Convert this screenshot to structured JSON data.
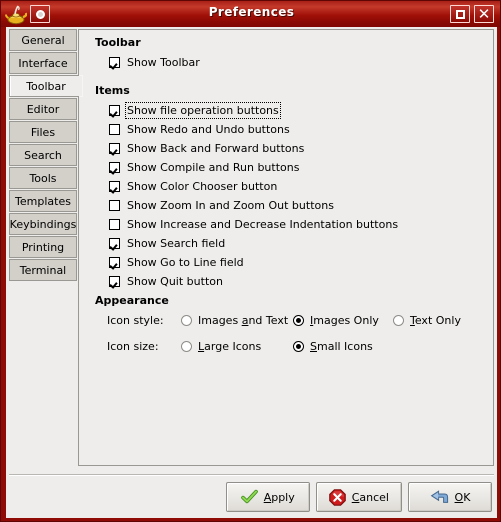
{
  "window": {
    "title": "Preferences",
    "app_icon": "genie-lamp-icon",
    "menu_button_icon": "window-menu-icon",
    "maximize_button_icon": "maximize-icon",
    "close_button_icon": "close-icon",
    "titlebar_color": "#a01008",
    "frame_color": "#8e0b06",
    "background_color": "#eeedeb"
  },
  "sidebar": {
    "items": [
      {
        "label": "General",
        "selected": false
      },
      {
        "label": "Interface",
        "selected": false
      },
      {
        "label": "Toolbar",
        "selected": true
      },
      {
        "label": "Editor",
        "selected": false
      },
      {
        "label": "Files",
        "selected": false
      },
      {
        "label": "Search",
        "selected": false
      },
      {
        "label": "Tools",
        "selected": false
      },
      {
        "label": "Templates",
        "selected": false
      },
      {
        "label": "Keybindings",
        "selected": false
      },
      {
        "label": "Printing",
        "selected": false
      },
      {
        "label": "Terminal",
        "selected": false
      }
    ]
  },
  "panel": {
    "toolbar_section": {
      "heading": "Toolbar",
      "options": [
        {
          "label": "Show Toolbar",
          "checked": true,
          "focused": false
        }
      ]
    },
    "items_section": {
      "heading": "Items",
      "options": [
        {
          "label": "Show file operation buttons",
          "checked": true,
          "focused": true
        },
        {
          "label": "Show Redo and Undo buttons",
          "checked": false,
          "focused": false
        },
        {
          "label": "Show Back and Forward buttons",
          "checked": true,
          "focused": false
        },
        {
          "label": "Show Compile and Run buttons",
          "checked": true,
          "focused": false
        },
        {
          "label": "Show Color Chooser button",
          "checked": true,
          "focused": false
        },
        {
          "label": "Show Zoom In and Zoom Out buttons",
          "checked": false,
          "focused": false
        },
        {
          "label": "Show Increase and Decrease Indentation buttons",
          "checked": false,
          "focused": false
        },
        {
          "label": "Show Search field",
          "checked": true,
          "focused": false
        },
        {
          "label": "Show Go to Line field",
          "checked": true,
          "focused": false
        },
        {
          "label": "Show Quit button",
          "checked": true,
          "focused": false
        }
      ]
    },
    "appearance_section": {
      "heading": "Appearance",
      "icon_style": {
        "label": "Icon style:",
        "options": [
          {
            "pre": "Images ",
            "accel": "a",
            "post": "nd Text",
            "selected": false
          },
          {
            "pre": "",
            "accel": "I",
            "post": "mages Only",
            "selected": true
          },
          {
            "pre": "",
            "accel": "T",
            "post": "ext Only",
            "selected": false
          }
        ]
      },
      "icon_size": {
        "label": "Icon size:",
        "options": [
          {
            "pre": "",
            "accel": "L",
            "post": "arge Icons",
            "selected": false
          },
          {
            "pre": "",
            "accel": "S",
            "post": "mall Icons",
            "selected": true
          }
        ]
      }
    }
  },
  "actions": {
    "apply": {
      "pre": "",
      "accel": "A",
      "post": "pply",
      "icon": "green-check-icon"
    },
    "cancel": {
      "pre": "",
      "accel": "C",
      "post": "ancel",
      "icon": "red-stop-icon"
    },
    "ok": {
      "pre": "",
      "accel": "O",
      "post": "K",
      "icon": "blue-arrow-icon"
    }
  }
}
